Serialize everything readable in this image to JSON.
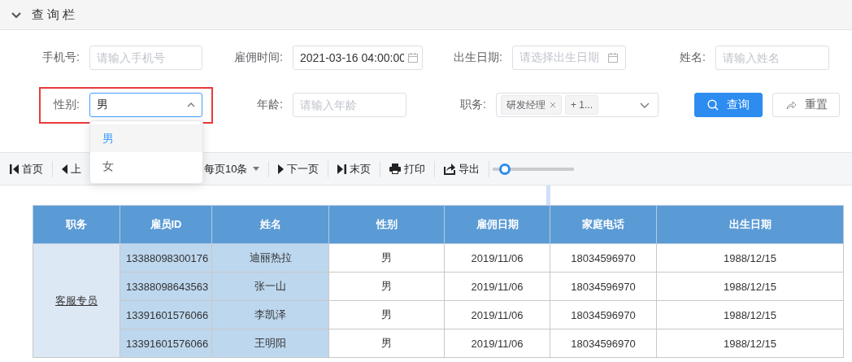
{
  "panel": {
    "title": "查询栏",
    "expanded": true
  },
  "filters": [
    {
      "kind": "text",
      "label": "手机号:",
      "placeholder": "请输入手机号"
    },
    {
      "kind": "date",
      "label": "雇佣时间:",
      "value": "2021-03-16 04:00:00"
    },
    {
      "kind": "date",
      "label": "出生日期:",
      "placeholder": "请选择出生日期"
    },
    {
      "kind": "text",
      "label": "姓名:",
      "placeholder": "请输入姓名"
    },
    {
      "kind": "select",
      "label": "性别:",
      "value": "男",
      "open": true,
      "highlighted": true,
      "options": [
        {
          "label": "男",
          "selected": true
        },
        {
          "label": "女",
          "selected": false
        }
      ]
    },
    {
      "kind": "text",
      "label": "年龄:",
      "placeholder": "请输入年龄"
    },
    {
      "kind": "tags",
      "label": "职务:",
      "tags": [
        {
          "label": "研发经理",
          "closable": true
        },
        {
          "label": "+ 1...",
          "closable": false
        }
      ]
    }
  ],
  "buttons": [
    {
      "kind": "primary",
      "label": "查询"
    },
    {
      "kind": "default",
      "label": "重置"
    }
  ],
  "toolbar": [
    {
      "kind": "first",
      "label": "首页"
    },
    {
      "kind": "prev",
      "label": "上"
    },
    {
      "kind": "pagesize",
      "label": "每页10条"
    },
    {
      "kind": "next",
      "label": "下一页"
    },
    {
      "kind": "last",
      "label": "末页"
    },
    {
      "kind": "print",
      "label": "打印"
    },
    {
      "kind": "export",
      "label": "导出"
    }
  ],
  "zoom": {
    "level": 0.15
  },
  "table": {
    "columns": [
      "职务",
      "雇员ID",
      "姓名",
      "性别",
      "雇佣日期",
      "家庭电话",
      "出生日期"
    ],
    "groups": [
      {
        "role": "客服专员",
        "rows": [
          [
            "13388098300176",
            "迪丽热拉",
            "男",
            "2019/11/06",
            "18034596970",
            "1988/12/15"
          ],
          [
            "13388098643563",
            "张一山",
            "男",
            "2019/11/06",
            "18034596970",
            "1988/12/15"
          ],
          [
            "13391601576066",
            "李凯泽",
            "男",
            "2019/11/06",
            "18034596970",
            "1988/12/15"
          ],
          [
            "13391601576066",
            "王明阳",
            "男",
            "2019/11/06",
            "18034596970",
            "1988/12/15"
          ]
        ]
      }
    ]
  }
}
